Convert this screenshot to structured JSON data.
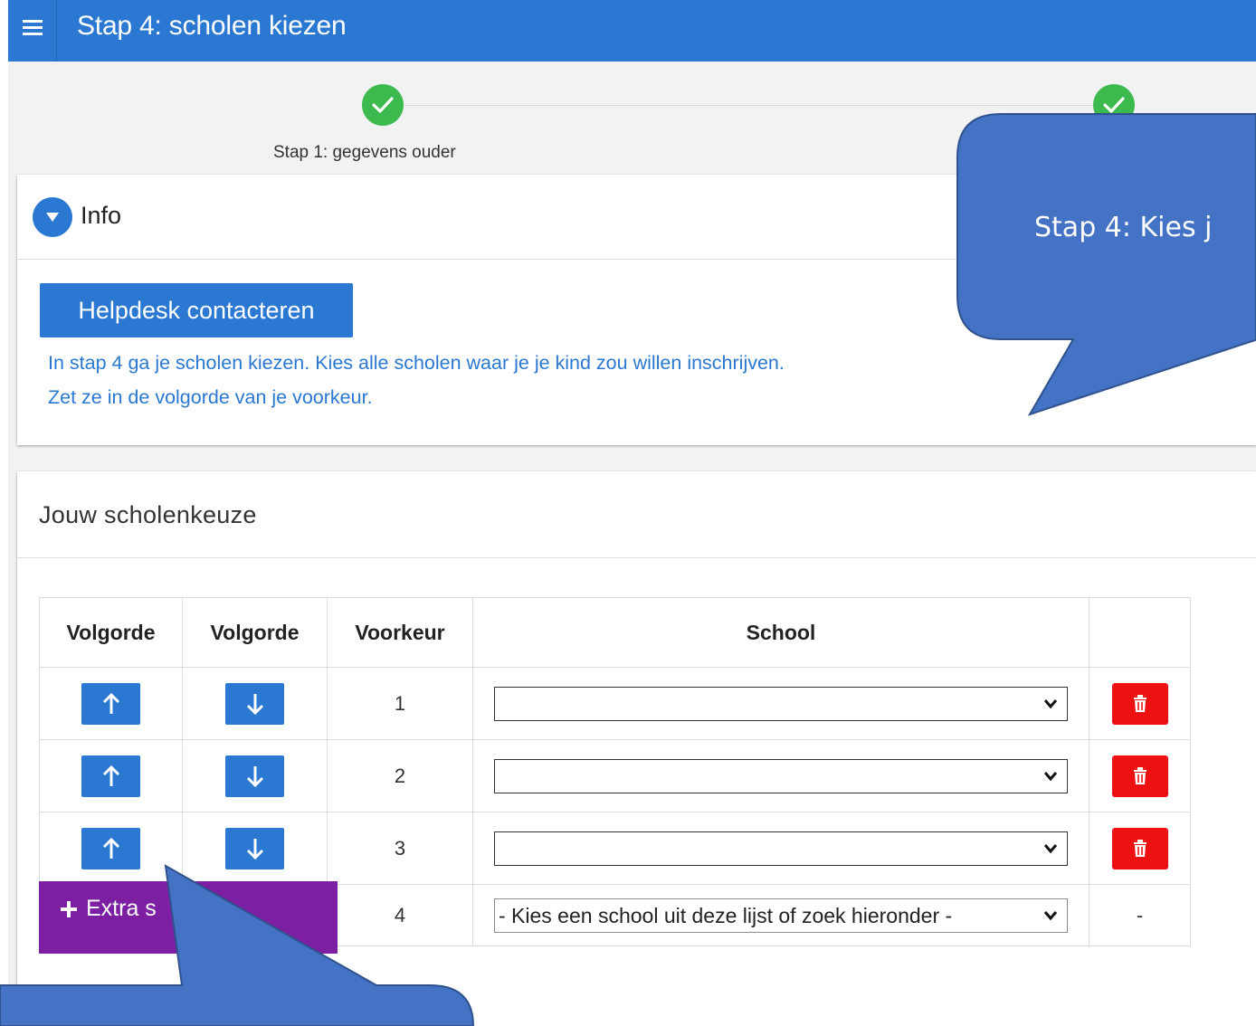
{
  "app": {
    "title": "Stap 4: scholen kiezen"
  },
  "stepper": {
    "step1_label": "Stap 1: gegevens ouder"
  },
  "info": {
    "title": "Info",
    "helpdesk_button": "Helpdesk contacteren",
    "text_line1": "In stap 4 ga je scholen kiezen. Kies alle scholen waar je je kind zou willen inschrijven.",
    "text_line2": "Zet ze in de volgorde van je voorkeur."
  },
  "choices": {
    "title": "Jouw scholenkeuze",
    "headers": [
      "Volgorde",
      "Volgorde",
      "Voorkeur",
      "School",
      ""
    ],
    "rows": [
      {
        "voorkeur": "1",
        "school": ""
      },
      {
        "voorkeur": "2",
        "school": ""
      },
      {
        "voorkeur": "3",
        "school": ""
      },
      {
        "voorkeur": "4",
        "school": "- Kies een school uit deze lijst of zoek hieronder -",
        "up": "-",
        "down": "-",
        "delete": "-"
      }
    ],
    "extra_button": "Extra s"
  },
  "callouts": {
    "top_right_text": "Stap 4: Kies j"
  },
  "colors": {
    "header": "#2a78d2",
    "success": "#3dba4e",
    "danger": "#ee1111",
    "extra": "#7c1fa3",
    "callout": "#4472c4"
  },
  "icons": [
    "menu-icon",
    "check-icon",
    "chevron-down-icon",
    "arrow-up-icon",
    "arrow-down-icon",
    "trash-icon",
    "plus-icon"
  ]
}
